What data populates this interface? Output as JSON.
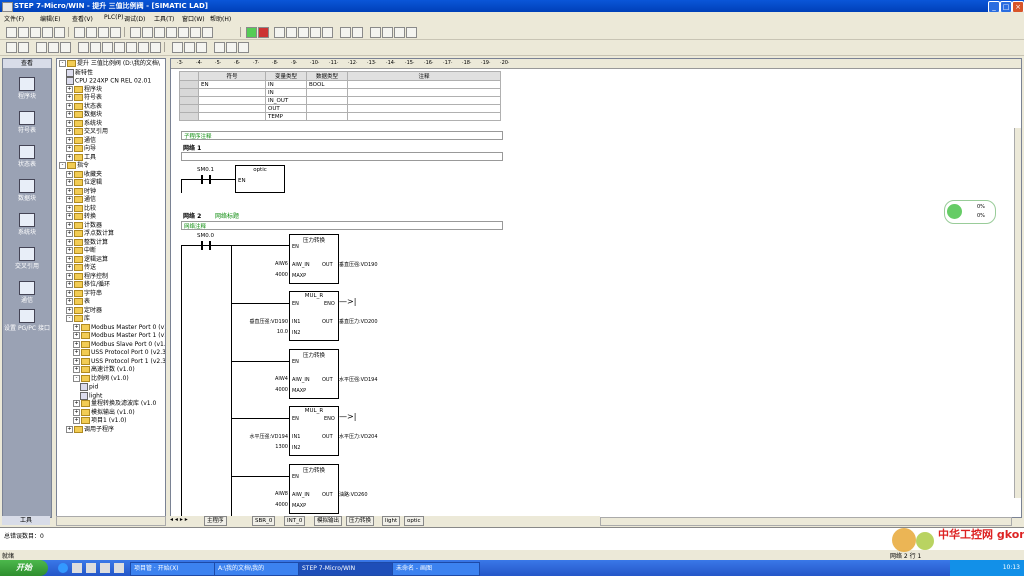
{
  "window": {
    "title": "STEP 7-Micro/WIN - 提升 三值比例阀 - [SIMATIC LAD]"
  },
  "menu": [
    "文件(F)",
    "编辑(E)",
    "查看(V)",
    "PLC(P)",
    "调试(D)",
    "工具(T)",
    "窗口(W)",
    "帮助(H)"
  ],
  "navbar": {
    "header": "查看",
    "items": [
      "程序块",
      "符号表",
      "状态表",
      "数据块",
      "系统块",
      "交叉引用",
      "通信",
      "设置 PG/PC 接口"
    ],
    "footer": "工具"
  },
  "tree": [
    {
      "d": 0,
      "ex": "-",
      "ic": "fi",
      "t": "提升 三值比例阀 (D:\\我的文档\\"
    },
    {
      "d": 1,
      "ex": "",
      "ic": "di",
      "t": "新特性"
    },
    {
      "d": 1,
      "ex": "",
      "ic": "di",
      "t": "CPU 224XP CN REL 02.01"
    },
    {
      "d": 1,
      "ex": "+",
      "ic": "fi",
      "t": "程序块"
    },
    {
      "d": 1,
      "ex": "+",
      "ic": "fi",
      "t": "符号表"
    },
    {
      "d": 1,
      "ex": "+",
      "ic": "fi",
      "t": "状态表"
    },
    {
      "d": 1,
      "ex": "+",
      "ic": "fi",
      "t": "数据块"
    },
    {
      "d": 1,
      "ex": "+",
      "ic": "fi",
      "t": "系统块"
    },
    {
      "d": 1,
      "ex": "+",
      "ic": "fi",
      "t": "交叉引用"
    },
    {
      "d": 1,
      "ex": "+",
      "ic": "fi",
      "t": "通信"
    },
    {
      "d": 1,
      "ex": "+",
      "ic": "fi",
      "t": "向导"
    },
    {
      "d": 1,
      "ex": "+",
      "ic": "fi",
      "t": "工具"
    },
    {
      "d": 0,
      "ex": "-",
      "ic": "fi",
      "t": "指令"
    },
    {
      "d": 1,
      "ex": "+",
      "ic": "fi",
      "t": "收藏夹"
    },
    {
      "d": 1,
      "ex": "+",
      "ic": "fi",
      "t": "位逻辑"
    },
    {
      "d": 1,
      "ex": "+",
      "ic": "fi",
      "t": "时钟"
    },
    {
      "d": 1,
      "ex": "+",
      "ic": "fi",
      "t": "通信"
    },
    {
      "d": 1,
      "ex": "+",
      "ic": "fi",
      "t": "比较"
    },
    {
      "d": 1,
      "ex": "+",
      "ic": "fi",
      "t": "转换"
    },
    {
      "d": 1,
      "ex": "+",
      "ic": "fi",
      "t": "计数器"
    },
    {
      "d": 1,
      "ex": "+",
      "ic": "fi",
      "t": "浮点数计算"
    },
    {
      "d": 1,
      "ex": "+",
      "ic": "fi",
      "t": "整数计算"
    },
    {
      "d": 1,
      "ex": "+",
      "ic": "fi",
      "t": "中断"
    },
    {
      "d": 1,
      "ex": "+",
      "ic": "fi",
      "t": "逻辑运算"
    },
    {
      "d": 1,
      "ex": "+",
      "ic": "fi",
      "t": "传送"
    },
    {
      "d": 1,
      "ex": "+",
      "ic": "fi",
      "t": "程序控制"
    },
    {
      "d": 1,
      "ex": "+",
      "ic": "fi",
      "t": "移位/循环"
    },
    {
      "d": 1,
      "ex": "+",
      "ic": "fi",
      "t": "字符串"
    },
    {
      "d": 1,
      "ex": "+",
      "ic": "fi",
      "t": "表"
    },
    {
      "d": 1,
      "ex": "+",
      "ic": "fi",
      "t": "定时器"
    },
    {
      "d": 1,
      "ex": "-",
      "ic": "fi",
      "t": "库"
    },
    {
      "d": 2,
      "ex": "+",
      "ic": "fi",
      "t": "Modbus Master Port 0 (v1"
    },
    {
      "d": 2,
      "ex": "+",
      "ic": "fi",
      "t": "Modbus Master Port 1 (v1"
    },
    {
      "d": 2,
      "ex": "+",
      "ic": "fi",
      "t": "Modbus Slave Port 0 (v1."
    },
    {
      "d": 2,
      "ex": "+",
      "ic": "fi",
      "t": "USS Protocol Port 0 (v2.3"
    },
    {
      "d": 2,
      "ex": "+",
      "ic": "fi",
      "t": "USS Protocol Port 1 (v2.3"
    },
    {
      "d": 2,
      "ex": "+",
      "ic": "fi",
      "t": "高速计数 (v1.0)"
    },
    {
      "d": 2,
      "ex": "-",
      "ic": "fi",
      "t": "比例阀 (v1.0)"
    },
    {
      "d": 3,
      "ex": "",
      "ic": "di",
      "t": "pid"
    },
    {
      "d": 3,
      "ex": "",
      "ic": "di",
      "t": "light"
    },
    {
      "d": 2,
      "ex": "+",
      "ic": "fi",
      "t": "量程转换及滤波库 (v1.0"
    },
    {
      "d": 2,
      "ex": "+",
      "ic": "fi",
      "t": "模拟输出 (v1.0)"
    },
    {
      "d": 2,
      "ex": "+",
      "ic": "fi",
      "t": "项目1 (v1.0)"
    },
    {
      "d": 1,
      "ex": "+",
      "ic": "fi",
      "t": "调用子程序"
    }
  ],
  "ruler": [
    "·3·",
    "·4·",
    "·5·",
    "·6·",
    "·7·",
    "·8·",
    "·9·",
    "·10·",
    "·11·",
    "·12·",
    "·13·",
    "·14·",
    "·15·",
    "·16·",
    "·17·",
    "·18·",
    "·19·",
    "·20·"
  ],
  "var_table": {
    "headers": [
      "符号",
      "变量类型",
      "数据类型",
      "注释"
    ],
    "rows": [
      [
        "EN",
        "IN",
        "BOOL",
        ""
      ],
      [
        "",
        "IN",
        "",
        ""
      ],
      [
        "",
        "IN_OUT",
        "",
        ""
      ],
      [
        "",
        "OUT",
        "",
        ""
      ],
      [
        "",
        "TEMP",
        "",
        ""
      ]
    ]
  },
  "ladder": {
    "comment_title": "子程序注释",
    "net1": {
      "label": "网络 1",
      "contact": "SM0.1",
      "box_title": "optic",
      "en": "EN"
    },
    "net2": {
      "label": "网络 2",
      "title": "网络标题",
      "comment": "网络注释",
      "contact": "SM0.0"
    },
    "blocks": [
      {
        "title": "压力转换",
        "in1_label": "AIW6",
        "in1_pin": "AIW_IN",
        "in2_label": "4000",
        "in2_pin": "MAXP",
        "out_pin": "OUT",
        "out_label": "垂直压强:VD190"
      },
      {
        "title": "MUL_R",
        "in1_label": "垂直压强:VD190",
        "in1_pin": "IN1",
        "in2_label": "10.0",
        "in2_pin": "IN2",
        "out_pin": "OUT",
        "out_label": "垂直压力:VD200",
        "eno": "ENO"
      },
      {
        "title": "压力转换",
        "in1_label": "AIW4",
        "in1_pin": "AIW_IN",
        "in2_label": "4000",
        "in2_pin": "MAXP",
        "out_pin": "OUT",
        "out_label": "水平压强:VD194"
      },
      {
        "title": "MUL_R",
        "in1_label": "水平压强:VD194",
        "in1_pin": "IN1",
        "in2_label": "1300",
        "in2_pin": "IN2",
        "out_pin": "OUT",
        "out_label": "水平压力:VD204",
        "eno": "ENO"
      },
      {
        "title": "压力转换",
        "in1_label": "AIW8",
        "in1_pin": "AIW_IN",
        "in2_label": "4000",
        "in2_pin": "MAXP",
        "out_pin": "OUT",
        "out_label": "油路:VD260"
      }
    ]
  },
  "tabs": [
    "主程序",
    "SBR_0",
    "INT_0",
    "模拟输出",
    "压力转换",
    "light",
    "optic"
  ],
  "output": {
    "text": "总错误数目：0"
  },
  "status": {
    "left": "就绪",
    "right": "网络 2  行 1"
  },
  "taskbar": {
    "start": "开始",
    "tasks": [
      "项目管 · 开始(X)",
      "A:\\我的文档\\我的",
      "STEP 7-Micro/WIN",
      "未命名 - 画图"
    ],
    "clock": "10:13"
  },
  "widget": {
    "a": "0%",
    "b": "0%"
  },
  "watermark": "中华工控网 gkong.com"
}
